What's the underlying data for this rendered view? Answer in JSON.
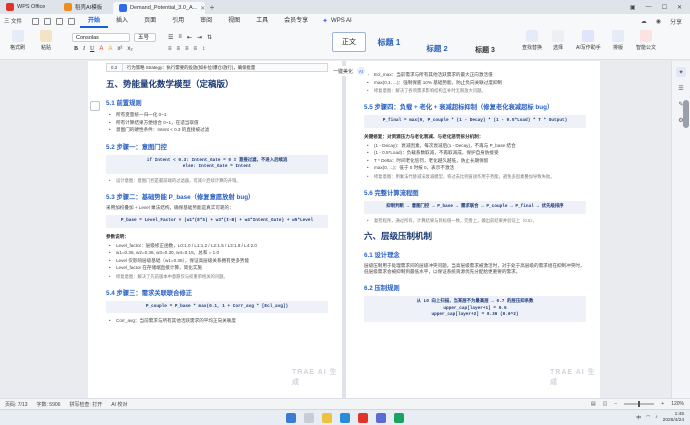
{
  "titlebar": {
    "tabs": [
      {
        "label": "WPS Office"
      },
      {
        "label": "稻壳AI模板"
      },
      {
        "label": "Demand_Potential_3.0_A..."
      }
    ]
  },
  "menubar": {
    "file_label": "三 文件",
    "items": [
      "开始",
      "插入",
      "页面",
      "引用",
      "审阅",
      "视图",
      "工具",
      "会员专享"
    ],
    "active": "开始",
    "ai_label": "WPS AI",
    "right_items": [
      "分享"
    ]
  },
  "ribbon": {
    "format_painter": "格式刷",
    "paste": "粘贴",
    "font_name": "Consolas",
    "font_size": "五号",
    "styles": [
      "正文",
      "标题 1",
      "标题 2",
      "标题 3"
    ],
    "find_replace": "查找替换",
    "select": "选择",
    "ai_write": "AI写作助手",
    "layout": "排版",
    "publish": "智能公文"
  },
  "page_left": {
    "table_row": {
      "num": "0.3",
      "text": "行为策略 Strategy：执行需要的投放(如补位/爆仓/放行)，确保批量"
    },
    "h2": "五、势能量化数学模型（定稿版）",
    "sec_51": {
      "title": "5.1 前置规则",
      "bullets": [
        "所有变量统一归一化 0~1",
        "所有计算结果方便组合 0~1，在适当取值",
        "意图门的硬性条件：Intent < 0.3 的直接被过滤"
      ]
    },
    "sec_52": {
      "title": "5.2 步骤一：意图门控",
      "code": [
        "if Intent < 0.3: Intent_Gate = 0  # 直接过滤，不进入后续流",
        "else: Intent_Gate = Intent"
      ],
      "note": "设计意图：意图门控是最前端的过滤器，可减少后续计算的开销。"
    },
    "sec_53": {
      "title": "5.3 步骤二：基础势能 P_base（修复意愿放射 bug）",
      "intro": "采用加权叠加 + Level 乘法结构，确保基础势能是真实可靠的：",
      "code": "P_base = Level_Factor × (w1*(E*S) + w3*(I-B) + w4*Intent_Gate) + w5*Level",
      "params_label": "参数说明：",
      "bullets": [
        "Level_factor：层级修正函数，L0:1.0 / L1:1.2 / L2:1.5 / L3:1.8 / L4:2.0",
        "w1=0.36, w2=0.36, w3=0.30, w4=0.15，总和 = 1.0",
        "Level 仅影响层级基础（w1=0.36），保证高层级关系拥有更多势能",
        "Level_factor 在存储端直接计算，简化实施"
      ],
      "note": "修复意图：解决了先前版本中意愿仅与权重单相关的问题。"
    },
    "sec_54": {
      "title": "5.4 步骤三：需求关联联合修正",
      "code": "P_couple = P_base * max(0.1, 1 + Corr_avg * [Ecl_avg])",
      "bullet": "Corr_avg：当前需求与所有其他活跃需求的平均正向关联度"
    },
    "watermark": "TRAE AI 生成"
  },
  "page_right": {
    "bullets_top": [
      "Ecl_max：当前需求与所有其他活跃需求的最大正向激活值",
      "max(0.1, ...)：强制保底 10% 基础势能，防止负向关联过度抑制"
    ],
    "note_top": "修复意图：解决了各项需求影响结构互补时无限放大问题。",
    "sec_55": {
      "title": "5.5 步骤四：负载 + 老化 + 衰减超标抑制（修复老化衰减超标 bug）",
      "code": "P_final = max(0, P_couple * (1 - Decay) * (1 - 0.5*Load) * T * Output)",
      "key_label": "关键修复：对资源压力与老化衰减、与老化惩罚拆分机制：",
      "bullets": [
        "(1 - Decay)：衰减因素，每次衰减后(1 - Decay)，不再与 P_base 结合",
        "(1 - 0.5*Load)：负载系数取减，不再取减成，保护自身防接受",
        "T * Delta：时间老化惩罚，老化越久越低，防止长期保留",
        "max(0, ...)：低于 0 时按 0，表示不激活"
      ],
      "note": "修复意图：用乘法代替减法衰减模型，将过去比例直接作用于势能，避免多因素叠加导致失败。"
    },
    "sec_56": {
      "title": "5.6 完整计算流程图",
      "code": "抑制判断 → 意图门控 → P_base → 需求联合 → P_couple → P_final → 优先级排序",
      "note": "复检程序，通过所有，计算结果与目标值一致，完善上，输出前结果并验证上（0.5）。"
    },
    "h2": "六、层级压制机制",
    "sec_61": {
      "title": "6.1 设计理念",
      "para": "层级压制用于处理需求间的层级冲突问题。当高层级需求被激活时，对于处于高层级的需求组在抑制冲突时，低层级需求会被抑制到最低水平，以保证系统资源优先分配给更重要的需求。"
    },
    "sec_62": {
      "title": "6.2 压制规则",
      "code": [
        "从 L0 向上扫描，当某层不为最高层 → 0.7 的层压抑系数",
        "upper_cap[layer+1] = 0.6",
        "upper_cap[layer+2] = 0.36 (0.6^2)"
      ]
    },
    "watermark": "TRAE AI 生成"
  },
  "float_label": {
    "text": "一键美化",
    "badge": "AI"
  },
  "statusbar": {
    "page": "页码: 7/13",
    "words": "字数: 5906",
    "spellcheck": "拼写检查: 打开",
    "ai_check": "AI 校对",
    "zoom": "120%"
  },
  "taskbar": {
    "lang": "中",
    "time": "1:45",
    "date": "2026/4/24"
  }
}
